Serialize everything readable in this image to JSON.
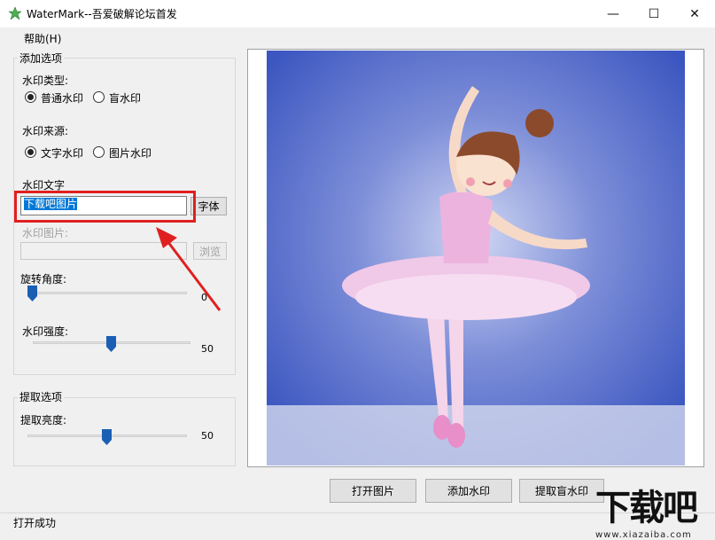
{
  "window": {
    "title": "WaterMark--吾爱破解论坛首发",
    "min_glyph": "—",
    "max_glyph": "☐",
    "close_glyph": "✕"
  },
  "menu": {
    "help": "帮助(H)"
  },
  "add_options": {
    "group_title": "添加选项",
    "type_label": "水印类型:",
    "type_options": [
      "普通水印",
      "盲水印"
    ],
    "type_selected": "普通水印",
    "source_label": "水印来源:",
    "source_options": [
      "文字水印",
      "图片水印"
    ],
    "source_selected": "文字水印",
    "text_label": "水印文字",
    "text_value": "下载吧图片",
    "font_button": "字体",
    "image_label": "水印图片:",
    "image_value": "",
    "browse_button": "浏览",
    "rotation_label": "旋转角度:",
    "rotation_value": "0",
    "strength_label": "水印强度:",
    "strength_value": "50"
  },
  "extract_options": {
    "group_title": "提取选项",
    "brightness_label": "提取亮度:",
    "brightness_value": "50"
  },
  "buttons": {
    "open_image": "打开图片",
    "add_watermark": "添加水印",
    "extract_blind": "提取盲水印"
  },
  "status": {
    "text": "打开成功"
  },
  "logo": {
    "main": "下载吧",
    "sub": "www.xiazaiba.com"
  },
  "colors": {
    "highlight": "#e02020",
    "selection": "#0078d7",
    "slider_thumb": "#1a5fb4",
    "tutu": "#f0c8e8",
    "background_blue": "#4a64c8"
  }
}
